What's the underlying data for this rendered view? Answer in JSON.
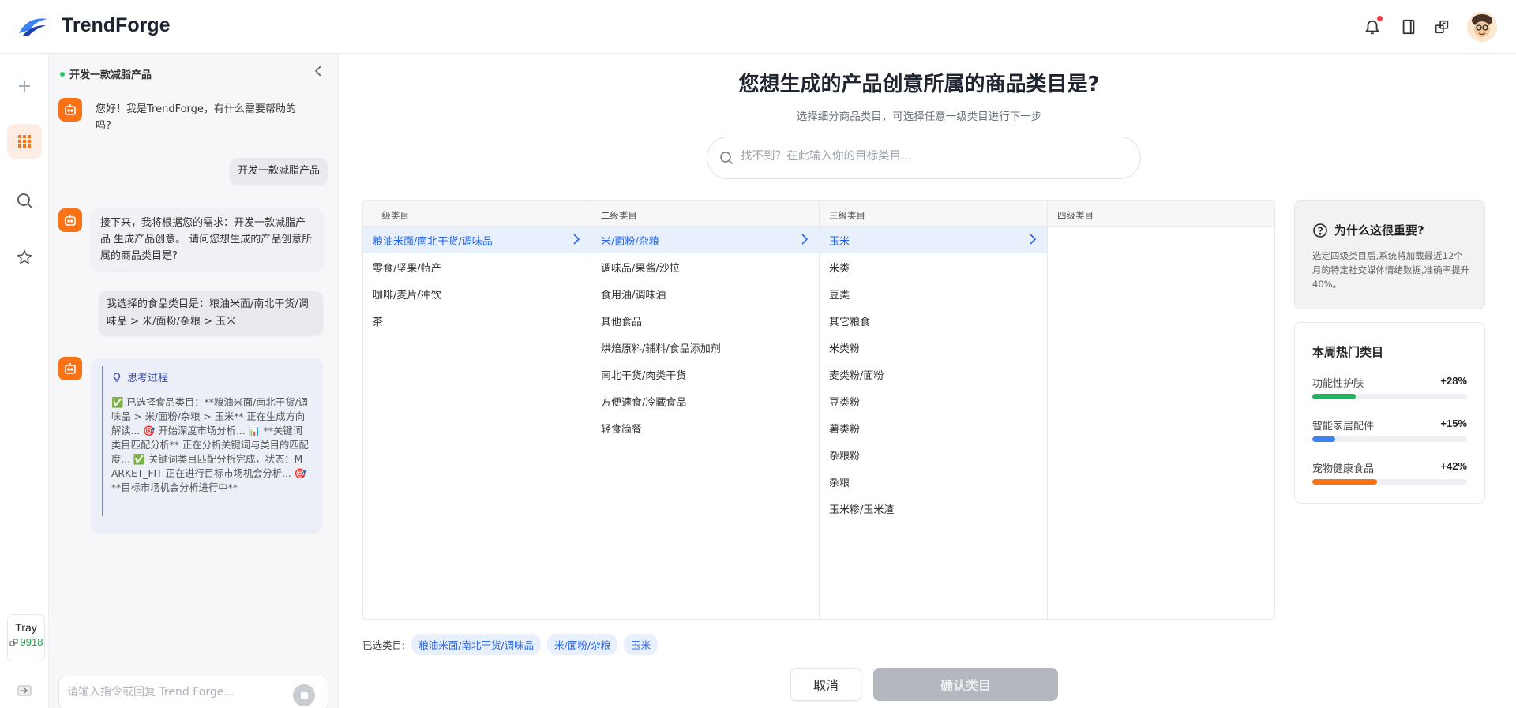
{
  "app": {
    "brand": "TrendForge"
  },
  "tray": {
    "title": "Tray",
    "value": "9918"
  },
  "chat": {
    "title": "开发一款减脂产品",
    "messages": [
      {
        "role": "bot",
        "text": "您好！我是TrendForge，有什么需要帮助的吗?"
      },
      {
        "role": "user",
        "text": "开发一款减脂产品"
      },
      {
        "role": "bot",
        "text": "接下来，我将根据您的需求：开发一款减脂产品 生成产品创意。 请问您想生成的产品创意所属的商品类目是?"
      },
      {
        "role": "user",
        "text": "我选择的食品类目是：粮油米面/南北干货/调味品 > 米/面粉/杂粮 > 玉米"
      }
    ],
    "thinking": {
      "label": "思考过程",
      "text": "✅ 已选择食品类目：**粮油米面/南北干货/调味品 > 米/面粉/杂粮 > 玉米** 正在生成方向解读... 🎯 开始深度市场分析... 📊 **关键词类目匹配分析** 正在分析关键词与类目的匹配度... ✅ 关键词类目匹配分析完成，状态：MARKET_FIT 正在进行目标市场机会分析... 🎯 **目标市场机会分析进行中**"
    },
    "input_placeholder": "请输入指令或回复 Trend Forge..."
  },
  "main": {
    "title": "您想生成的产品创意所属的商品类目是?",
    "subtitle": "选择细分商品类目，可选择任意一级类目进行下一步",
    "search_placeholder": "找不到？在此输入你的目标类目..."
  },
  "columns": [
    {
      "header": "一级类目",
      "items": [
        "粮油米面/南北干货/调味品",
        "零食/坚果/特产",
        "咖啡/麦片/冲饮",
        "茶"
      ],
      "selected": 0
    },
    {
      "header": "二级类目",
      "items": [
        "米/面粉/杂粮",
        "调味品/果酱/沙拉",
        "食用油/调味油",
        "其他食品",
        "烘焙原料/辅料/食品添加剂",
        "南北干货/肉类干货",
        "方便速食/冷藏食品",
        "轻食简餐"
      ],
      "selected": 0
    },
    {
      "header": "三级类目",
      "items": [
        "玉米",
        "米类",
        "豆类",
        "其它粮食",
        "米类粉",
        "麦类粉/面粉",
        "豆类粉",
        "薯类粉",
        "杂粮粉",
        "杂粮",
        "玉米糁/玉米渣"
      ],
      "selected": 0
    },
    {
      "header": "四级类目",
      "items": [],
      "selected": -1
    }
  ],
  "why": {
    "title": "为什么这很重要?",
    "body": "选定四级类目后,系统将加载最近12个月的特定社交媒体情绪数据,准确率提升40%。"
  },
  "hot": {
    "title": "本周热门类目",
    "items": [
      {
        "name": "功能性护肤",
        "pct": "+28%",
        "level": 0.28,
        "color": "#22b35e"
      },
      {
        "name": "智能家居配件",
        "pct": "+15%",
        "level": 0.15,
        "color": "#3b82f6"
      },
      {
        "name": "宠物健康食品",
        "pct": "+42%",
        "level": 0.42,
        "color": "#f97316"
      }
    ]
  },
  "selection": {
    "label": "已选类目:",
    "chips": [
      "粮油米面/南北干货/调味品",
      "米/面粉/杂粮",
      "玉米"
    ]
  },
  "buttons": {
    "cancel": "取消",
    "confirm": "确认类目"
  }
}
